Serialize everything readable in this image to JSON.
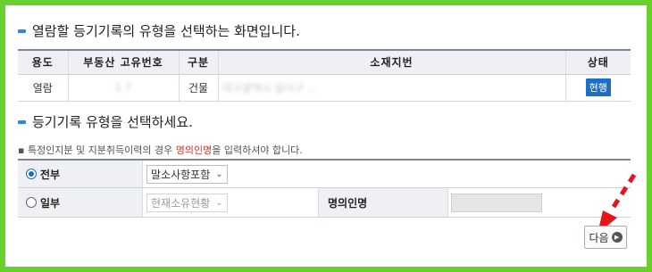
{
  "title1": "열람할 등기기록의 유형을 선택하는 화면입니다.",
  "info_table": {
    "headers": [
      "용도",
      "부동산 고유번호",
      "구분",
      "소재지번",
      "상태"
    ],
    "row": {
      "purpose": "열람",
      "unique_no": "1                    7",
      "type": "건물",
      "address": "대구광역시 달서구 ...",
      "status": "현행"
    }
  },
  "title2": "등기기록 유형을 선택하세요.",
  "note": {
    "prefix": "▪ 특정인지분 및 지분취득이력의 경우 ",
    "highlight": "명의인명",
    "suffix": "을 입력하셔야 합니다."
  },
  "form": {
    "all_label": "전부",
    "all_select": "말소사항포함",
    "part_label": "일부",
    "part_select": "현재소유현황",
    "owner_label": "명의인명",
    "owner_value": ""
  },
  "next_button": "다음",
  "colors": {
    "frame": "#67d02a",
    "accent": "#1b6fc9",
    "arrow": "#e8141b"
  },
  "selected_option": "전부"
}
